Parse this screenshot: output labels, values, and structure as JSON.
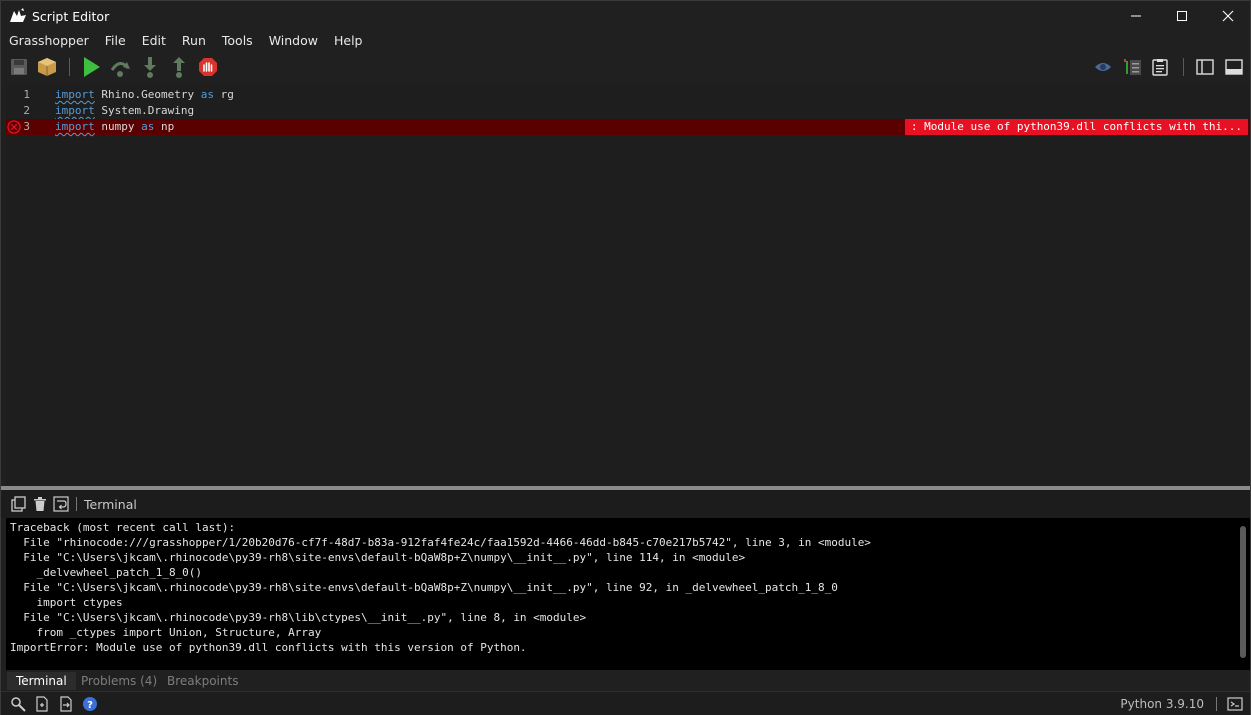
{
  "window": {
    "title": "Script Editor",
    "icon": "rhino-icon",
    "controls": [
      "minimize-icon",
      "maximize-icon",
      "close-icon"
    ]
  },
  "menu": [
    "Grasshopper",
    "File",
    "Edit",
    "Run",
    "Tools",
    "Window",
    "Help"
  ],
  "toolbar": {
    "left": [
      "save-icon",
      "package-icon",
      "run-icon",
      "step-over-icon",
      "step-into-icon",
      "step-out-icon",
      "stop-icon"
    ],
    "right": [
      "preview-icon",
      "indent-icon",
      "clipboard-icon",
      "sidebar-toggle-icon",
      "panel-toggle-icon"
    ]
  },
  "editor": {
    "lines": [
      {
        "number": "1",
        "keyword": "import",
        "rest": "Rhino.Geometry",
        "as": "as",
        "alias": "rg",
        "error": false
      },
      {
        "number": "2",
        "keyword": "import",
        "rest": "System.Drawing",
        "as": "",
        "alias": "",
        "error": false
      },
      {
        "number": "3",
        "keyword": "import",
        "rest": "numpy",
        "as": "as",
        "alias": "np",
        "error": true
      }
    ],
    "error_message": ": Module use of python39.dll conflicts with thi..."
  },
  "terminal": {
    "title": "Terminal",
    "header_icons": [
      "copy-icon",
      "trash-icon",
      "wrap-icon"
    ],
    "lines": [
      "Traceback (most recent call last):",
      "  File \"rhinocode:///grasshopper/1/20b20d76-cf7f-48d7-b83a-912faf4fe24c/faa1592d-4466-46dd-b845-c70e217b5742\", line 3, in <module>",
      "  File \"C:\\Users\\jkcam\\.rhinocode\\py39-rh8\\site-envs\\default-bQaW8p+Z\\numpy\\__init__.py\", line 114, in <module>",
      "    _delvewheel_patch_1_8_0()",
      "  File \"C:\\Users\\jkcam\\.rhinocode\\py39-rh8\\site-envs\\default-bQaW8p+Z\\numpy\\__init__.py\", line 92, in _delvewheel_patch_1_8_0",
      "    import ctypes",
      "  File \"C:\\Users\\jkcam\\.rhinocode\\py39-rh8\\lib\\ctypes\\__init__.py\", line 8, in <module>",
      "    from _ctypes import Union, Structure, Array",
      "ImportError: Module use of python39.dll conflicts with this version of Python."
    ]
  },
  "tabs": [
    {
      "label": "Terminal",
      "active": true
    },
    {
      "label": "Problems (4)",
      "active": false
    },
    {
      "label": "Breakpoints",
      "active": false
    }
  ],
  "status": {
    "icons": [
      "search-icon",
      "file-add-icon",
      "file-export-icon",
      "help-icon"
    ],
    "version": "Python 3.9.10",
    "right_icon": "console-icon"
  },
  "colors": {
    "error_line": "#5a0000",
    "error_badge": "#e81123",
    "keyword": "#569cd6",
    "run_green": "#3fbf3f",
    "stop_red": "#d9332b"
  }
}
